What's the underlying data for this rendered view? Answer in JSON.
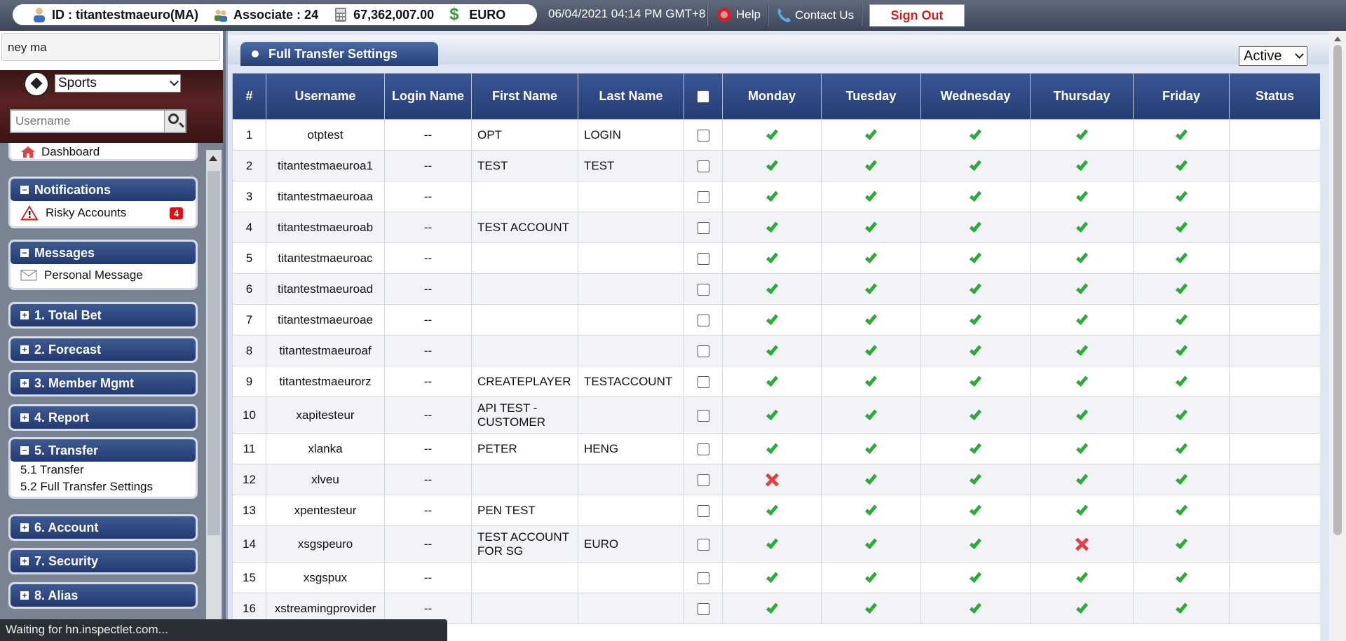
{
  "topbar": {
    "id_text": "ID : titantestmaeuro(MA)",
    "associate_text": "Associate : 24",
    "balance": "67,362,007.00",
    "currency": "EURO",
    "datetime": "06/04/2021 04:14 PM GMT+8",
    "help": "Help",
    "contact": "Contact Us",
    "signout": "Sign Out"
  },
  "sidebar": {
    "top_search_value": "ney ma",
    "sports_select": "Sports",
    "username_placeholder": "Username",
    "dashboard": "Dashboard",
    "sections": [
      {
        "title": "Notifications",
        "expanded": true,
        "items": [
          {
            "label": "Risky Accounts",
            "badge": "4"
          }
        ]
      },
      {
        "title": "Messages",
        "expanded": true,
        "items": [
          {
            "label": "Personal Message"
          }
        ]
      },
      {
        "title": "1. Total Bet"
      },
      {
        "title": "2. Forecast"
      },
      {
        "title": "3. Member Mgmt"
      },
      {
        "title": "4. Report"
      },
      {
        "title": "5. Transfer",
        "expanded": true,
        "items": [
          {
            "label": "5.1 Transfer"
          },
          {
            "label": "5.2 Full Transfer Settings"
          }
        ]
      },
      {
        "title": "6. Account"
      },
      {
        "title": "7. Security"
      },
      {
        "title": "8. Alias"
      }
    ]
  },
  "status_bar": "Waiting for hn.inspectlet.com...",
  "main": {
    "title": "Full Transfer Settings",
    "status_filter": "Active",
    "columns": [
      "#",
      "Username",
      "Login Name",
      "First Name",
      "Last Name",
      "",
      "Monday",
      "Tuesday",
      "Wednesday",
      "Thursday",
      "Friday",
      "Status"
    ],
    "rows": [
      {
        "n": "1",
        "username": "otptest",
        "login": "--",
        "first": "OPT",
        "last": "LOGIN",
        "days": [
          true,
          true,
          true,
          true,
          true
        ]
      },
      {
        "n": "2",
        "username": "titantestmaeuroa1",
        "login": "--",
        "first": "TEST",
        "last": "TEST",
        "days": [
          true,
          true,
          true,
          true,
          true
        ]
      },
      {
        "n": "3",
        "username": "titantestmaeuroaa",
        "login": "--",
        "first": "",
        "last": "",
        "days": [
          true,
          true,
          true,
          true,
          true
        ]
      },
      {
        "n": "4",
        "username": "titantestmaeuroab",
        "login": "--",
        "first": "TEST ACCOUNT",
        "last": "",
        "days": [
          true,
          true,
          true,
          true,
          true
        ]
      },
      {
        "n": "5",
        "username": "titantestmaeuroac",
        "login": "--",
        "first": "",
        "last": "",
        "days": [
          true,
          true,
          true,
          true,
          true
        ]
      },
      {
        "n": "6",
        "username": "titantestmaeuroad",
        "login": "--",
        "first": "",
        "last": "",
        "days": [
          true,
          true,
          true,
          true,
          true
        ]
      },
      {
        "n": "7",
        "username": "titantestmaeuroae",
        "login": "--",
        "first": "",
        "last": "",
        "days": [
          true,
          true,
          true,
          true,
          true
        ]
      },
      {
        "n": "8",
        "username": "titantestmaeuroaf",
        "login": "--",
        "first": "",
        "last": "",
        "days": [
          true,
          true,
          true,
          true,
          true
        ]
      },
      {
        "n": "9",
        "username": "titantestmaeurorz",
        "login": "--",
        "first": "CREATEPLAYER",
        "last": "TESTACCOUNT",
        "days": [
          true,
          true,
          true,
          true,
          true
        ]
      },
      {
        "n": "10",
        "username": "xapitesteur",
        "login": "--",
        "first": "API TEST - CUSTOMER",
        "last": "",
        "days": [
          true,
          true,
          true,
          true,
          true
        ]
      },
      {
        "n": "11",
        "username": "xlanka",
        "login": "--",
        "first": "PETER",
        "last": "HENG",
        "days": [
          true,
          true,
          true,
          true,
          true
        ]
      },
      {
        "n": "12",
        "username": "xlveu",
        "login": "--",
        "first": "",
        "last": "",
        "days": [
          false,
          true,
          true,
          true,
          true
        ]
      },
      {
        "n": "13",
        "username": "xpentesteur",
        "login": "--",
        "first": "PEN TEST",
        "last": "",
        "days": [
          true,
          true,
          true,
          true,
          true
        ]
      },
      {
        "n": "14",
        "username": "xsgspeuro",
        "login": "--",
        "first": "TEST ACCOUNT FOR SG",
        "last": "EURO",
        "days": [
          true,
          true,
          true,
          false,
          true
        ]
      },
      {
        "n": "15",
        "username": "xsgspux",
        "login": "--",
        "first": "",
        "last": "",
        "days": [
          true,
          true,
          true,
          true,
          true
        ]
      },
      {
        "n": "16",
        "username": "xstreamingprovider",
        "login": "--",
        "first": "",
        "last": "",
        "days": [
          true,
          true,
          true,
          true,
          true
        ]
      }
    ]
  },
  "colors": {
    "accent": "#243d74",
    "tick": "#2faa3a",
    "cross": "#e0403f",
    "signout": "#cc2222"
  }
}
